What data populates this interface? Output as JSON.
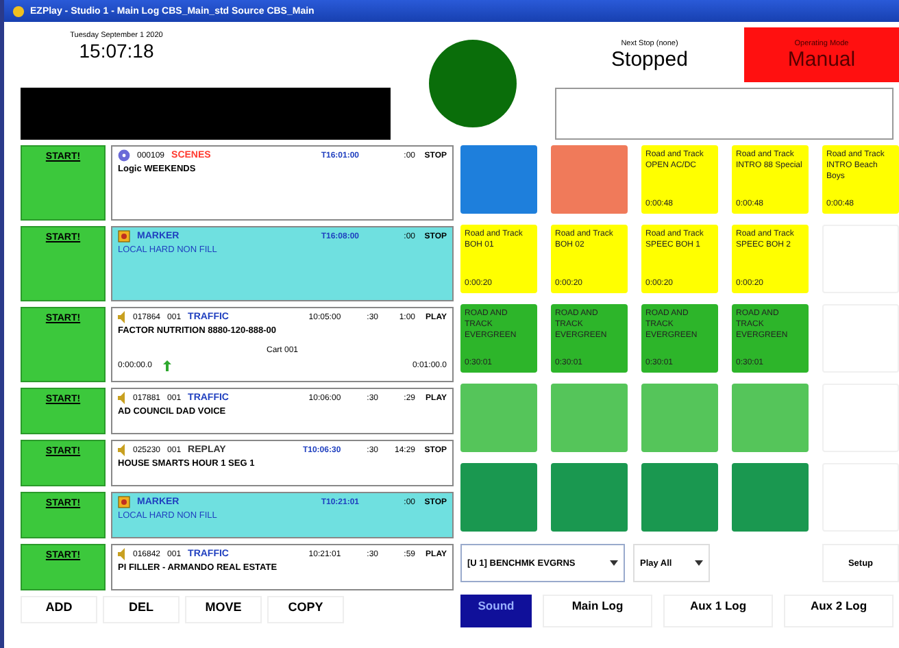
{
  "window": {
    "title": "EZPlay - Studio 1 - Main Log CBS_Main_std Source CBS_Main"
  },
  "clock": {
    "date": "Tuesday September 1 2020",
    "time": "15:07:18"
  },
  "on_air": {
    "on": true
  },
  "next_stop": {
    "label": "Next Stop (none)",
    "value": "Stopped"
  },
  "mode": {
    "label": "Operating Mode",
    "value": "Manual"
  },
  "log_rows": [
    {
      "kind": "event",
      "start": "START!",
      "number": "000109",
      "category": "SCENES",
      "color": "#ff3b30",
      "time": "T16:01:00",
      "timed": true,
      "length": ":00",
      "action": "STOP",
      "title": "Logic WEEKENDS"
    },
    {
      "kind": "marker",
      "start": "START!",
      "category": "MARKER",
      "time": "T16:08:00",
      "timed": true,
      "length": ":00",
      "action": "STOP",
      "title": "LOCAL HARD NON FILL"
    },
    {
      "kind": "audio",
      "start": "START!",
      "number": "017864",
      "cut": "001",
      "category": "TRAFFIC",
      "color": "#1f3fbf",
      "time": "10:05:00",
      "timed": false,
      "intro": ":30",
      "length": "1:00",
      "action": "PLAY",
      "title": "FACTOR NUTRITION 8880-120-888-00",
      "cart": "Cart 001",
      "elapsed": "0:00:00.0",
      "remaining": "0:01:00.0"
    },
    {
      "kind": "audio",
      "start": "START!",
      "number": "017881",
      "cut": "001",
      "category": "TRAFFIC",
      "color": "#1f3fbf",
      "time": "10:06:00",
      "timed": false,
      "intro": ":30",
      "length": ":29",
      "action": "PLAY",
      "title": "AD COUNCIL DAD VOICE"
    },
    {
      "kind": "audio",
      "start": "START!",
      "number": "025230",
      "cut": "001",
      "category": "REPLAY",
      "color": "#333333",
      "time": "T10:06:30",
      "timed": true,
      "intro": ":30",
      "length": "14:29",
      "action": "STOP",
      "title": "HOUSE SMARTS HOUR 1 SEG 1"
    },
    {
      "kind": "marker",
      "start": "START!",
      "category": "MARKER",
      "time": "T10:21:01",
      "timed": true,
      "length": ":00",
      "action": "STOP",
      "title": "LOCAL HARD NON FILL"
    },
    {
      "kind": "audio",
      "start": "START!",
      "number": "016842",
      "cut": "001",
      "category": "TRAFFIC",
      "color": "#1f3fbf",
      "time": "10:21:01",
      "timed": false,
      "intro": ":30",
      "length": ":59",
      "action": "PLAY",
      "title": "PI FILLER - ARMANDO REAL ESTATE"
    }
  ],
  "pads": [
    {
      "color": "#1e7fdc"
    },
    {
      "color": "#f07a5a"
    },
    {
      "color": "#ffff00",
      "label": "Road and Track OPEN AC/DC",
      "duration": "0:00:48"
    },
    {
      "color": "#ffff00",
      "label": "Road and Track INTRO 88 Special",
      "duration": "0:00:48"
    },
    {
      "color": "#ffff00",
      "label": "Road and Track INTRO Beach Boys",
      "duration": "0:00:48"
    },
    {
      "color": "#ffff00",
      "label": "Road and Track BOH 01",
      "duration": "0:00:20"
    },
    {
      "color": "#ffff00",
      "label": "Road and Track BOH 02",
      "duration": "0:00:20"
    },
    {
      "color": "#ffff00",
      "label": "Road and Track SPEEC BOH 1",
      "duration": "0:00:20"
    },
    {
      "color": "#ffff00",
      "label": "Road and Track SPEEC BOH 2",
      "duration": "0:00:20"
    },
    {
      "color": "#ffffff"
    },
    {
      "color": "#2db52a",
      "label": "ROAD AND TRACK EVERGREEN",
      "duration": "0:30:01"
    },
    {
      "color": "#2db52a",
      "label": "ROAD AND TRACK EVERGREEN",
      "duration": "0:30:01"
    },
    {
      "color": "#2db52a",
      "label": "ROAD AND TRACK EVERGREEN",
      "duration": "0:30:01"
    },
    {
      "color": "#2db52a",
      "label": "ROAD AND TRACK EVERGREEN",
      "duration": "0:30:01"
    },
    {
      "color": "#ffffff"
    },
    {
      "color": "#55c55a"
    },
    {
      "color": "#55c55a"
    },
    {
      "color": "#55c55a"
    },
    {
      "color": "#55c55a"
    },
    {
      "color": "#ffffff"
    },
    {
      "color": "#1a9850"
    },
    {
      "color": "#1a9850"
    },
    {
      "color": "#1a9850"
    },
    {
      "color": "#1a9850"
    },
    {
      "color": "#ffffff"
    }
  ],
  "pad_bank": {
    "value": "[U 1] BENCHMK EVGRNS"
  },
  "play_mode": {
    "value": "Play All"
  },
  "setup_button": "Setup",
  "log_buttons": [
    "ADD",
    "DEL",
    "MOVE",
    "COPY"
  ],
  "tabs": [
    {
      "label": "Sound",
      "selected": true
    },
    {
      "label": "Main Log",
      "selected": false
    },
    {
      "label": "Aux 1 Log",
      "selected": false
    },
    {
      "label": "Aux 2 Log",
      "selected": false
    }
  ]
}
